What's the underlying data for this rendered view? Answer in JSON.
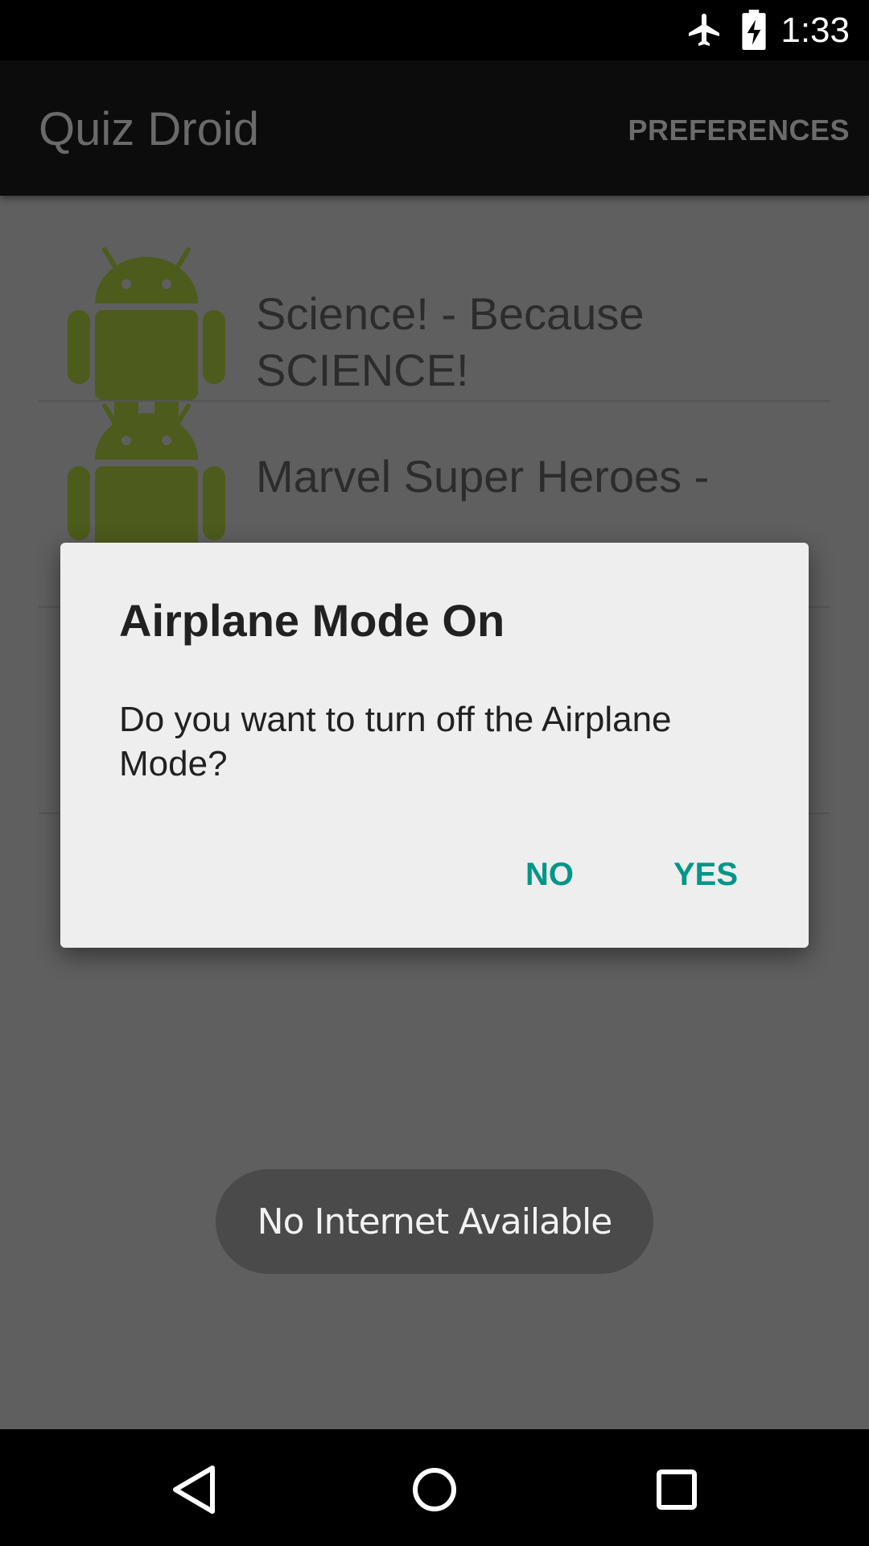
{
  "status_bar": {
    "time": "1:33",
    "icons": [
      "airplane-icon",
      "battery-charging-icon"
    ]
  },
  "app_bar": {
    "title": "Quiz Droid",
    "action": "PREFERENCES"
  },
  "list": {
    "items": [
      {
        "icon": "android-robot-icon",
        "label": "Science! - Because SCIENCE!"
      },
      {
        "icon": "android-robot-icon",
        "label": "Marvel Super Heroes -"
      }
    ]
  },
  "dialog": {
    "title": "Airplane Mode On",
    "message": "Do you want to turn off the Airplane Mode?",
    "negative": "NO",
    "positive": "YES",
    "accent_color": "#009688"
  },
  "toast": {
    "text": "No Internet Available"
  },
  "nav_bar": {
    "icons": [
      "back-icon",
      "home-icon",
      "recents-icon"
    ]
  }
}
